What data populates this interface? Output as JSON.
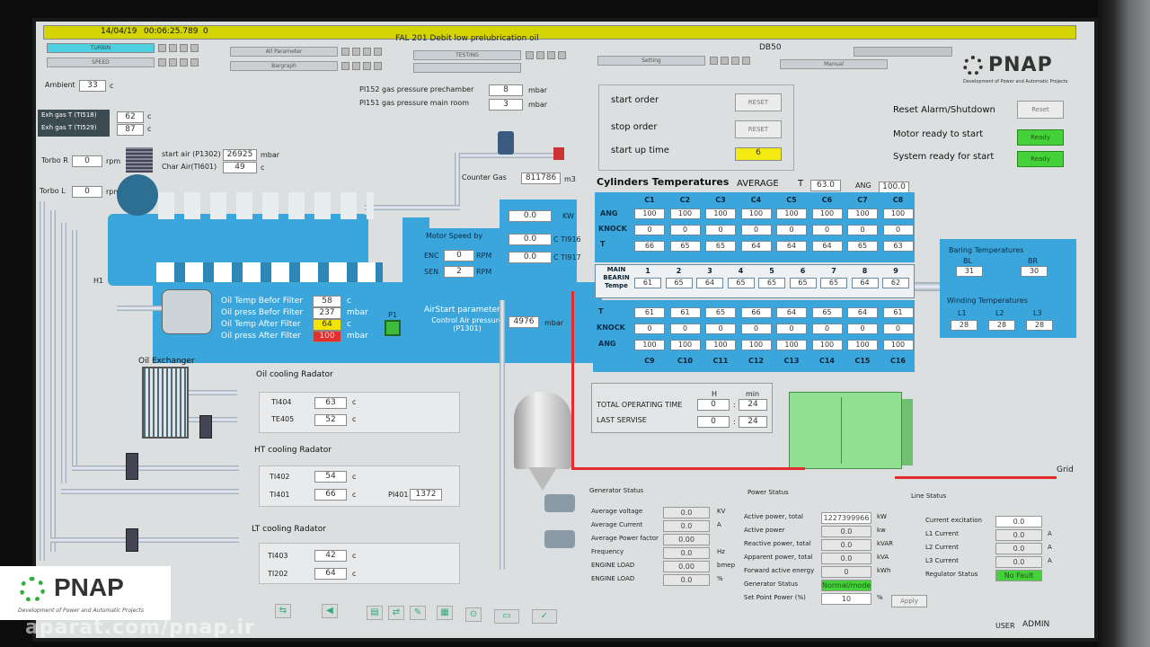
{
  "header": {
    "date": "14/04/19",
    "time": "00:06:25.789",
    "counter": "0",
    "alarm_title": "FAL 201 Debit low prelubrication oil",
    "db": "DB50"
  },
  "nav": {
    "turbin": "TURBIN",
    "speed": "SPEED",
    "all_parameter": "All Parameter",
    "bargraph": "Bargraph",
    "tab3": "TESTING",
    "setting": "Setting",
    "manual": "Manual"
  },
  "logo": {
    "name": "PNAP",
    "tagline": "Development of Power and Automatic Projects"
  },
  "ambient": {
    "label": "Ambient",
    "value": "33",
    "unit": "c"
  },
  "exh": {
    "t1_label": "Exh gas T (TI518)",
    "t1_value": "62",
    "t2_label": "Exh gas T (TI529)",
    "t2_value": "87",
    "unit": "c"
  },
  "turbo": {
    "r_label": "Torbo R",
    "r_value": "0",
    "l_label": "Torbo L",
    "l_value": "0",
    "unit": "rpm"
  },
  "start_air": {
    "label": "start air (P1302)",
    "value": "26925",
    "unit": "mbar",
    "char_label": "Char Air(TI601)",
    "char_value": "49",
    "char_unit": "c"
  },
  "gas_pressure": {
    "pre_label": "PI152 gas pressure prechamber",
    "pre_value": "8",
    "main_label": "PI151 gas pressure main room",
    "main_value": "3",
    "unit": "mbar"
  },
  "counter_gas": {
    "label": "Counter Gas",
    "value": "811786",
    "unit": "m3"
  },
  "motor_speed": {
    "title": "Motor Speed by",
    "enc_label": "ENC",
    "enc_value": "0",
    "sen_label": "SEN",
    "sen_value": "2",
    "unit": "RPM"
  },
  "power_block": {
    "kw": "0.0",
    "kw_unit": "KW",
    "t916": "0.0",
    "t916_label": "C TI916",
    "t917": "0.0",
    "t917_label": "C TI917"
  },
  "airstart": {
    "title": "AirStart parameter",
    "label": "Control Air pressure (P1301)",
    "value": "4976",
    "unit": "mbar"
  },
  "oil": {
    "t_before_label": "Oil Temp Befor Filter",
    "t_before": "58",
    "p_before_label": "Oil press Befor Filter",
    "p_before": "237",
    "t_after_label": "Oil Temp After Filter",
    "t_after": "64",
    "p_after_label": "Oil press After Filter",
    "p_after": "100",
    "unit_c": "c",
    "unit_mbar": "mbar",
    "p1": "P1",
    "h1": "H1"
  },
  "oil_exchanger": "Oil Exchanger",
  "oil_radator": {
    "title": "Oil cooling Radator",
    "r1_label": "TI404",
    "r1_value": "63",
    "r2_label": "TE405",
    "r2_value": "52",
    "unit": "c"
  },
  "ht_radator": {
    "title": "HT cooling Radator",
    "r1_label": "TI402",
    "r1_value": "54",
    "r2_label": "TI401",
    "r2_value": "66",
    "unit": "c",
    "pi_label": "PI401",
    "pi_value": "1372"
  },
  "lt_radator": {
    "title": "LT cooling Radator",
    "r1_label": "TI403",
    "r1_value": "42",
    "r2_label": "TI202",
    "r2_value": "64",
    "unit": "c"
  },
  "orders": {
    "start_label": "start order",
    "stop_label": "stop order",
    "startup_label": "start up time",
    "reset": "RESET",
    "startup_value": "6"
  },
  "status_right": {
    "reset_alarm": "Reset Alarm/Shutdown",
    "reset_btn": "Reset",
    "motor_ready": "Motor ready to start",
    "system_ready": "System ready for start",
    "ready": "Ready"
  },
  "cylinders": {
    "title": "Cylinders Temperatures",
    "avg_label": "AVERAGE",
    "t_label": "T",
    "avg_t": "63.0",
    "ang_label": "ANG",
    "avg_ang": "100.0",
    "top_headers": [
      "C1",
      "C2",
      "C3",
      "C4",
      "C5",
      "C6",
      "C7",
      "C8"
    ],
    "row_labels": [
      "ANG",
      "KNOCK",
      "T"
    ],
    "top_ang": [
      "100",
      "100",
      "100",
      "100",
      "100",
      "100",
      "100",
      "100"
    ],
    "top_knock": [
      "0",
      "0",
      "0",
      "0",
      "0",
      "0",
      "0",
      "0"
    ],
    "top_t": [
      "66",
      "65",
      "65",
      "64",
      "64",
      "64",
      "65",
      "63"
    ],
    "bearing_label": "MAIN BEARIN Tempe",
    "bearing_nums": [
      "1",
      "2",
      "3",
      "4",
      "5",
      "6",
      "7",
      "8",
      "9"
    ],
    "bearing_vals": [
      "61",
      "65",
      "64",
      "65",
      "65",
      "65",
      "65",
      "64",
      "62"
    ],
    "bot_t": [
      "61",
      "61",
      "65",
      "66",
      "64",
      "65",
      "64",
      "61"
    ],
    "bot_knock": [
      "0",
      "0",
      "0",
      "0",
      "0",
      "0",
      "0",
      "0"
    ],
    "bot_ang": [
      "100",
      "100",
      "100",
      "100",
      "100",
      "100",
      "100",
      "100"
    ],
    "bot_headers": [
      "C9",
      "C10",
      "C11",
      "C12",
      "C13",
      "C14",
      "C15",
      "C16"
    ]
  },
  "baring": {
    "title": "Baring Temperatures",
    "bl": "BL",
    "bl_value": "31",
    "br": "BR",
    "br_value": "30"
  },
  "winding": {
    "title": "Winding Temperatures",
    "l1": "L1",
    "l1_value": "28",
    "l2": "L2",
    "l2_value": "28",
    "l3": "L3",
    "l3_value": "28"
  },
  "operating": {
    "h": "H",
    "min": "min",
    "total_label": "TOTAL OPERATING TIME",
    "total_h": "0",
    "total_min": "24",
    "last_label": "LAST SERVISE",
    "last_h": "0",
    "last_min": "24"
  },
  "grid": "Grid",
  "generator": {
    "title": "Generator Status",
    "rows": [
      {
        "label": "Average voltage",
        "value": "0.0",
        "unit": "KV"
      },
      {
        "label": "Average Current",
        "value": "0.0",
        "unit": "A"
      },
      {
        "label": "Average Power factor",
        "value": "0.00",
        "unit": ""
      },
      {
        "label": "Frequency",
        "value": "0.0",
        "unit": "Hz"
      },
      {
        "label": "ENGINE LOAD",
        "value": "0.00",
        "unit": "bmep"
      },
      {
        "label": "ENGINE LOAD",
        "value": "0.0",
        "unit": "%"
      }
    ]
  },
  "power": {
    "title": "Power Status",
    "rows": [
      {
        "label": "Active power, total",
        "value": "1227399966",
        "unit": "kW"
      },
      {
        "label": "Active power",
        "value": "0.0",
        "unit": "kw"
      },
      {
        "label": "Reactive power, total",
        "value": "0.0",
        "unit": "kVAR"
      },
      {
        "label": "Apparent power, total",
        "value": "0.0",
        "unit": "kVA"
      },
      {
        "label": "Forward active energy",
        "value": "0",
        "unit": "kWh"
      },
      {
        "label": "Generator Status",
        "value": "Normal/mode",
        "unit": ""
      },
      {
        "label": "Set Point Power (%)",
        "value": "10",
        "unit": "%"
      }
    ],
    "apply": "Apply"
  },
  "line": {
    "title": "Line Status",
    "rows": [
      {
        "label": "Current excitation",
        "value": "0.0",
        "unit": ""
      },
      {
        "label": "L1 Current",
        "value": "0.0",
        "unit": "A"
      },
      {
        "label": "L2 Current",
        "value": "0.0",
        "unit": "A"
      },
      {
        "label": "L3 Current",
        "value": "0.0",
        "unit": "A"
      },
      {
        "label": "Regulator Status",
        "value": "No Fault",
        "unit": ""
      }
    ]
  },
  "footer": {
    "user_label": "USER",
    "user": "ADMIN",
    "watermark": "aparat.com/pnap.ir",
    "overlay_logo": "PNAP",
    "overlay_tag": "Development of Power and Automatic Projects"
  }
}
